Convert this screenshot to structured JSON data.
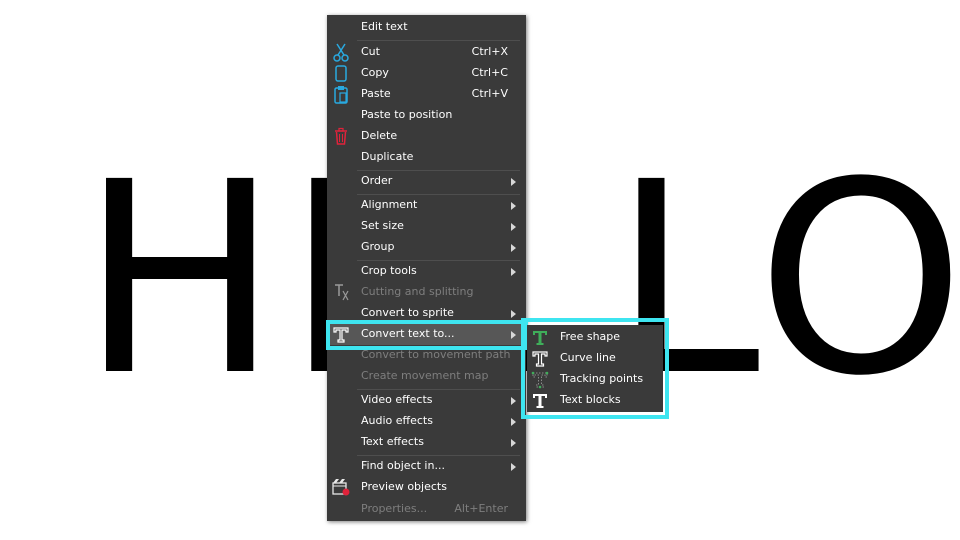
{
  "canvas": {
    "text": "HELLO"
  },
  "context_menu": {
    "items": [
      {
        "label": "Edit text"
      },
      {
        "label": "Cut",
        "shortcut": "Ctrl+X",
        "icon": "scissors-icon"
      },
      {
        "label": "Copy",
        "shortcut": "Ctrl+C",
        "icon": "copy-icon"
      },
      {
        "label": "Paste",
        "shortcut": "Ctrl+V",
        "icon": "paste-icon"
      },
      {
        "label": "Paste to position"
      },
      {
        "label": "Delete",
        "icon": "trash-icon"
      },
      {
        "label": "Duplicate"
      },
      {
        "label": "Order",
        "has_submenu": true
      },
      {
        "label": "Alignment",
        "has_submenu": true
      },
      {
        "label": "Set size",
        "has_submenu": true
      },
      {
        "label": "Group",
        "has_submenu": true
      },
      {
        "label": "Crop tools",
        "has_submenu": true
      },
      {
        "label": "Cutting and splitting",
        "disabled": true,
        "icon": "split-icon"
      },
      {
        "label": "Convert to sprite",
        "has_submenu": true
      },
      {
        "label": "Convert text to...",
        "has_submenu": true,
        "selected": true,
        "icon": "text-icon"
      },
      {
        "label": "Convert to movement path",
        "disabled": true
      },
      {
        "label": "Create movement map",
        "disabled": true
      },
      {
        "label": "Video effects",
        "has_submenu": true
      },
      {
        "label": "Audio effects",
        "has_submenu": true
      },
      {
        "label": "Text effects",
        "has_submenu": true
      },
      {
        "label": "Find object in...",
        "has_submenu": true
      },
      {
        "label": "Preview objects",
        "icon": "preview-icon"
      },
      {
        "label": "Properties...",
        "shortcut": "Alt+Enter",
        "disabled": true
      }
    ]
  },
  "submenu": {
    "items": [
      {
        "label": "Free shape",
        "icon": "text-green-icon"
      },
      {
        "label": "Curve line",
        "icon": "text-outline-icon"
      },
      {
        "label": "Tracking points",
        "icon": "text-points-icon"
      },
      {
        "label": "Text blocks",
        "icon": "text-bold-icon"
      }
    ]
  },
  "colors": {
    "menu_bg": "#3a3a3a",
    "highlight": "#3ee5f0",
    "disabled_text": "#7e7e7e",
    "icon_blue": "#29a9e0",
    "icon_red": "#e0223a",
    "icon_green": "#3fae5a"
  }
}
